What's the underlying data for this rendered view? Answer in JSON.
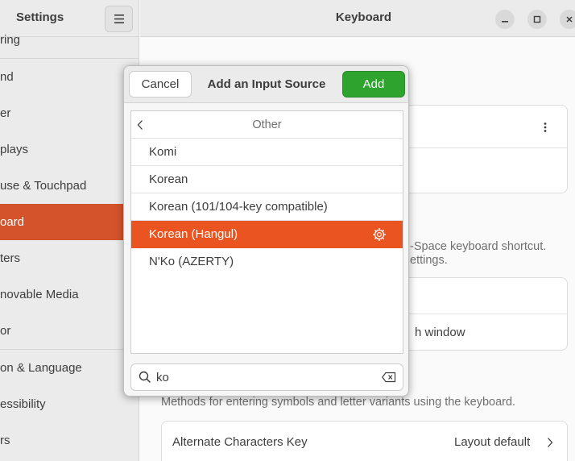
{
  "sidebar": {
    "title": "Settings",
    "menu_icon": "hamburger-icon",
    "items": [
      {
        "label": "ring"
      },
      {
        "label": "nd"
      },
      {
        "label": "er"
      },
      {
        "label": "plays"
      },
      {
        "label": "use & Touchpad"
      },
      {
        "label": "oard"
      },
      {
        "label": "ters"
      },
      {
        "label": "novable Media"
      },
      {
        "label": "or"
      },
      {
        "label": "on & Language"
      },
      {
        "label": "essibility"
      },
      {
        "label": "rs"
      }
    ]
  },
  "header": {
    "title": "Keyboard",
    "minimize_icon": "minimize-icon",
    "maximize_icon": "maximize-icon",
    "close_icon": "close-icon"
  },
  "main": {
    "kebab_icon": "kebab-menu-icon",
    "shortcut_text_1": "-Space keyboard shortcut.",
    "shortcut_text_2": "ettings.",
    "window_option": "h window",
    "special_chars_desc": "Methods for entering symbols and letter variants using the keyboard.",
    "alt_chars_label": "Alternate Characters Key",
    "alt_chars_value": "Layout default"
  },
  "dialog": {
    "title": "Add an Input Source",
    "cancel_label": "Cancel",
    "add_label": "Add",
    "section_label": "Other",
    "back_icon": "back-arrow-icon",
    "rows": [
      {
        "label": "Komi"
      },
      {
        "label": "Korean"
      },
      {
        "label": "Korean (101/104-key compatible)"
      },
      {
        "label": "Korean (Hangul)"
      },
      {
        "label": "N'Ko (AZERTY)"
      }
    ],
    "selected_row_icon": "input-method-engine-icon",
    "search": {
      "value": "ko",
      "search_icon": "search-icon",
      "clear_icon": "clear-text-icon"
    }
  },
  "colors": {
    "accent": "#e95420",
    "sidebar_active": "#d5532a",
    "add_button": "#2ea32e"
  }
}
